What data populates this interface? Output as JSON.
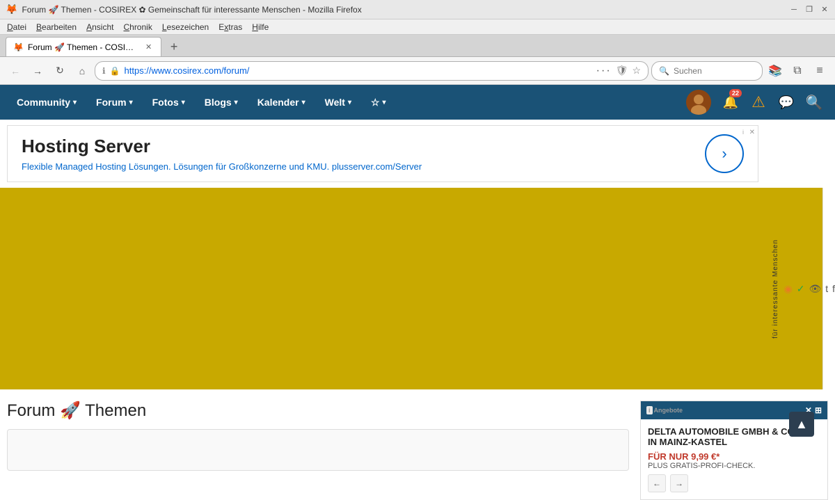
{
  "browser": {
    "titlebar": "Forum 🚀 Themen - COSIREX ✿ Gemeinschaft für interessante Menschen - Mozilla Firefox",
    "tab_label": "Forum 🚀 Themen - COSIREX",
    "url": "https://www.cosirex.com/forum/",
    "search_placeholder": "Suchen",
    "menu_items": [
      "Datei",
      "Bearbeiten",
      "Ansicht",
      "Chronik",
      "Lesezeichen",
      "Extras",
      "Hilfe"
    ]
  },
  "site_nav": {
    "items": [
      {
        "label": "Community",
        "has_dropdown": true
      },
      {
        "label": "Forum",
        "has_dropdown": true
      },
      {
        "label": "Fotos",
        "has_dropdown": true
      },
      {
        "label": "Blogs",
        "has_dropdown": true
      },
      {
        "label": "Kalender",
        "has_dropdown": true
      },
      {
        "label": "Welt",
        "has_dropdown": true
      },
      {
        "label": "☆",
        "has_dropdown": true
      }
    ],
    "badge_count": "22"
  },
  "ad_banner": {
    "title": "Hosting Server",
    "description": "Flexible Managed Hosting Lösungen. Lösungen für Großkonzerne und KMU.",
    "link_text": "plusserver.com/Server",
    "arrow": "›"
  },
  "right_strip": {
    "icons": [
      "f",
      "t",
      "👁",
      "✓",
      "rss"
    ],
    "text": "für interessante Menschen"
  },
  "page": {
    "title": "Forum 🚀 Themen"
  },
  "right_ad": {
    "label": "Angebote",
    "company": "DELTA AUTOMOBILE GMBH & CO. KG IN MAINZ-KASTEL",
    "price_text": "FÜR NUR 9,99 €*",
    "desc": "PLUS GRATIS-PROFI-CHECK."
  },
  "back_to_top": "▲"
}
